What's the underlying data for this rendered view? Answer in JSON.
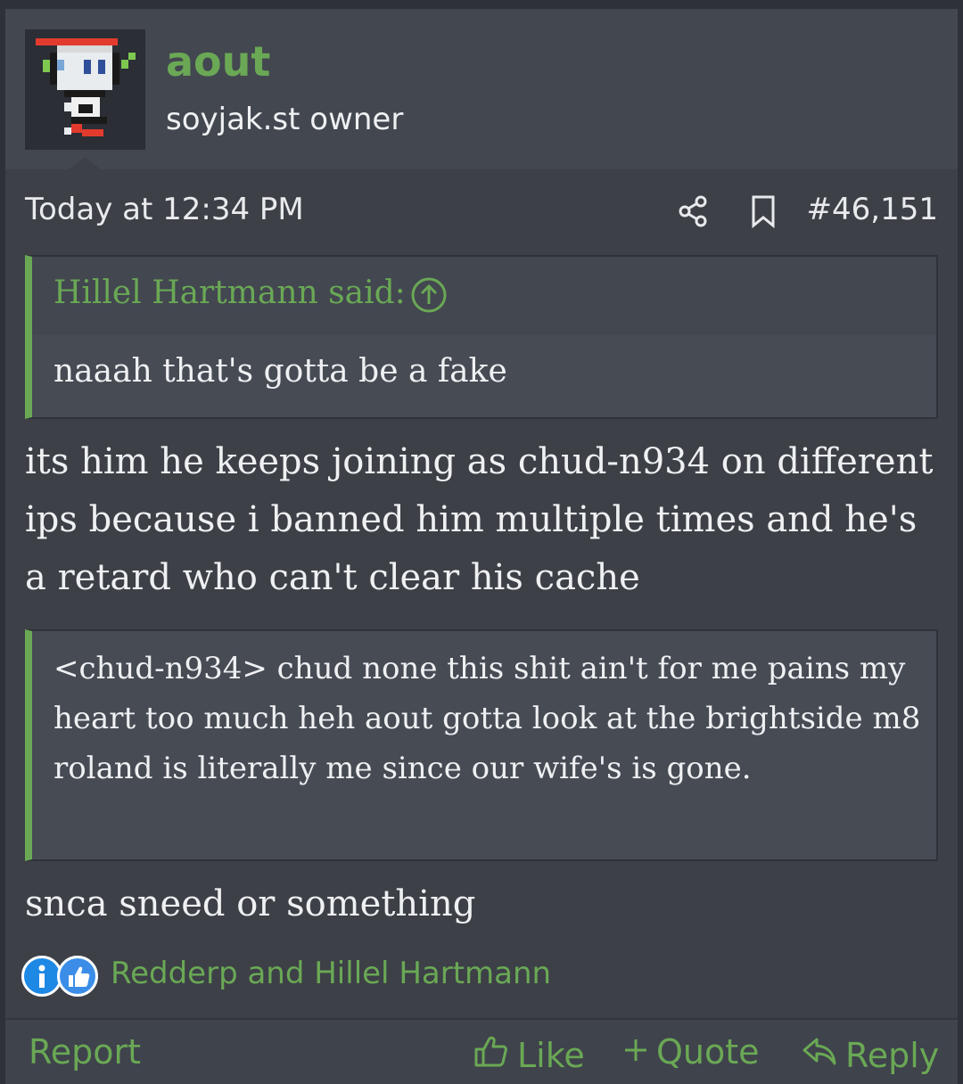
{
  "post": {
    "user": {
      "name": "aout",
      "title": "soyjak.st owner"
    },
    "meta": {
      "date": "Today at 12:34 PM",
      "number": "#46,151"
    },
    "quote1": {
      "author": "Hillel Hartmann said:",
      "text": "naaah that's gotta be a fake"
    },
    "message1": "its him he keeps joining as chud-n934 on different ips because i banned him multiple times and he's a retard who can't clear his cache",
    "quote2": {
      "text": "<chud-n934> chud none this shit ain't for me pains my heart too much heh aout gotta look at the brightside m8 roland is literally me since our wife's is gone."
    },
    "message2": "snca sneed or something",
    "reactions": {
      "icons": [
        "info-icon",
        "like-icon"
      ],
      "users": "Redderp and Hillel Hartmann"
    },
    "actions": {
      "report": "Report",
      "like": "Like",
      "quote": "Quote",
      "reply": "Reply"
    }
  },
  "colors": {
    "accent": "#6aa855",
    "background": "#3d4047",
    "header": "#434750",
    "text": "#eef0f2"
  }
}
